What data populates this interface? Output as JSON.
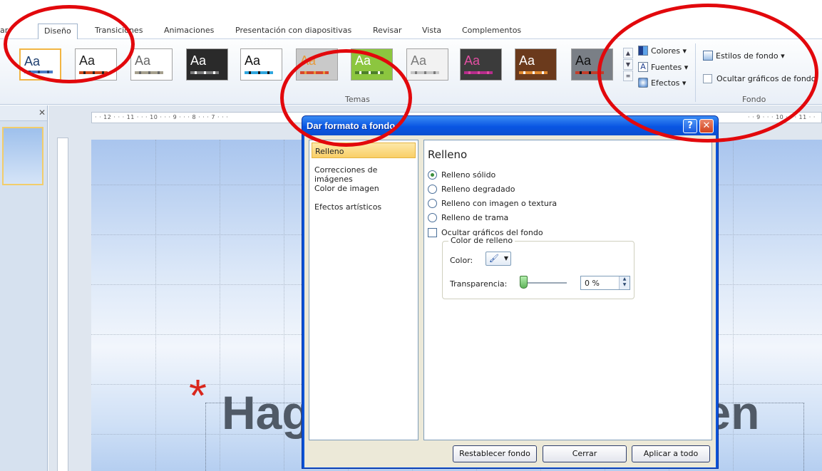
{
  "ribbon": {
    "tabs": [
      {
        "label": "ar"
      },
      {
        "label": "Diseño"
      },
      {
        "label": "Transiciones"
      },
      {
        "label": "Animaciones"
      },
      {
        "label": "Presentación con diapositivas"
      },
      {
        "label": "Revisar"
      },
      {
        "label": "Vista"
      },
      {
        "label": "Complementos"
      }
    ],
    "themes_group": {
      "label": "Temas",
      "themes": [
        {
          "sample": "Aa",
          "bg": "#ffffff",
          "fg": "#1f3f6f",
          "strip": "#4a7dc9"
        },
        {
          "sample": "Aa",
          "bg": "#ffffff",
          "fg": "#222222",
          "strip": "#d14c1d"
        },
        {
          "sample": "Aa",
          "bg": "#ffffff",
          "fg": "#666666",
          "strip": "#a6a08e"
        },
        {
          "sample": "Aa",
          "bg": "#2a2a2a",
          "fg": "#ffffff",
          "strip": "#7f7f7f"
        },
        {
          "sample": "Aa",
          "bg": "#ffffff",
          "fg": "#111111",
          "strip": "#2fa6de"
        },
        {
          "sample": "Aa",
          "bg": "#c9c9c9",
          "fg": "#e69a3c",
          "strip": "#d9462b"
        },
        {
          "sample": "Aa",
          "bg": "#8cc63f",
          "fg": "#ffffff",
          "strip": "#4d7f2a"
        },
        {
          "sample": "Aa",
          "bg": "#f2f2f2",
          "fg": "#7a7a7a",
          "strip": "#c5c5c5"
        },
        {
          "sample": "Aa",
          "bg": "#3b3b3b",
          "fg": "#e34fa3",
          "strip": "#b62d8c"
        },
        {
          "sample": "Aa",
          "bg": "#6b3a1c",
          "fg": "#ffffff",
          "strip": "#e38a2f"
        },
        {
          "sample": "Aa",
          "bg": "#7a7f86",
          "fg": "#111111",
          "strip": "#c23d2a"
        }
      ]
    },
    "colors_btn": "Colores ▾",
    "fonts_btn": "Fuentes ▾",
    "effects_btn": "Efectos ▾",
    "background_group": {
      "label": "Fondo",
      "styles_btn": "Estilos de fondo ▾",
      "hide_graphics": "Ocultar gráficos de fondo"
    }
  },
  "workspace": {
    "ruler_text": "· · 12 · · · 11 · · · 10 · · · 9 · · · 8 · · · 7 · · ·",
    "ruler_text_right": "· · 9 · · · 10 · · · 11 · ·",
    "slide_title": "Hag",
    "slide_title_rest": "ar un Buen"
  },
  "dialog": {
    "title": "Dar formato a fondo",
    "nav": [
      {
        "label": "Relleno"
      },
      {
        "label": "Correcciones de imágenes"
      },
      {
        "label": "Color de imagen"
      },
      {
        "label": "Efectos artísticos"
      }
    ],
    "panel": {
      "heading": "Relleno",
      "options": [
        {
          "label": "Relleno sólido",
          "selected": true
        },
        {
          "label": "Relleno degradado",
          "selected": false
        },
        {
          "label": "Relleno con imagen o textura",
          "selected": false
        },
        {
          "label": "Relleno de trama",
          "selected": false
        }
      ],
      "hide_graphics": "Ocultar gráficos del fondo",
      "fill_group": "Color de relleno",
      "color_label": "Color:",
      "transparency_label": "Transparencia:",
      "transparency_value": "0 %",
      "transparency_level": 0
    },
    "buttons": {
      "reset": "Restablecer fondo",
      "close": "Cerrar",
      "apply_all": "Aplicar a todo"
    }
  },
  "colors": {
    "annotation_red": "#e2080c",
    "dialog_blue": "#0c54d8",
    "selection_gold": "#f9cf67"
  }
}
